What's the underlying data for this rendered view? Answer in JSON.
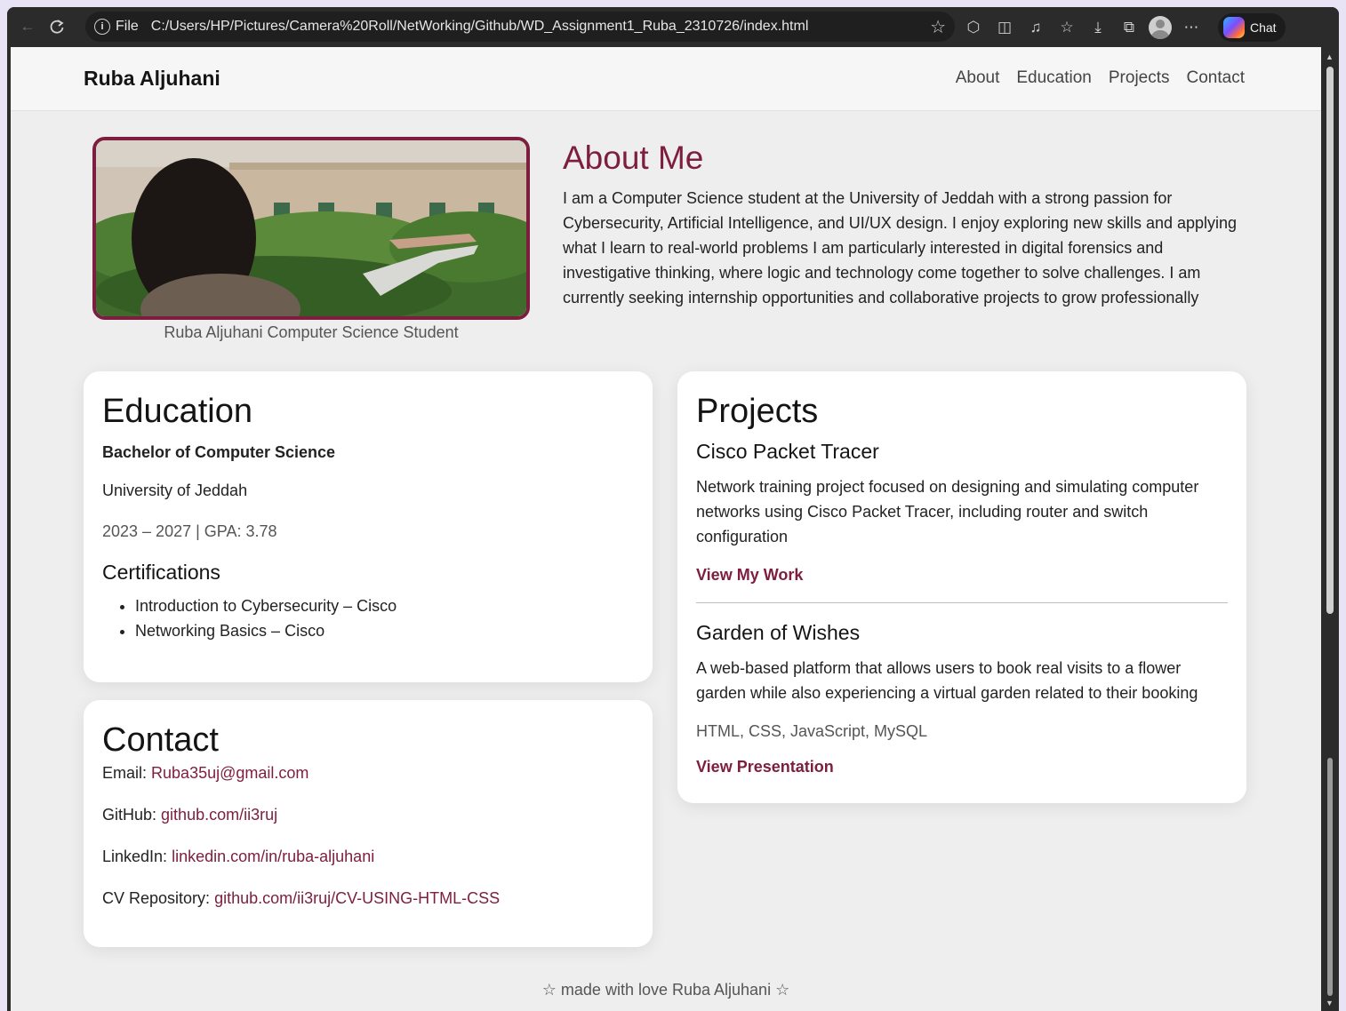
{
  "browser": {
    "back_icon": "←",
    "refresh_icon": "C",
    "file_label": "File",
    "url": "C:/Users/HP/Pictures/Camera%20Roll/NetWorking/Github/WD_Assignment1_Ruba_2310726/index.html",
    "chat_label": "Chat"
  },
  "header": {
    "brand": "Ruba Aljuhani",
    "nav": [
      "About",
      "Education",
      "Projects",
      "Contact"
    ]
  },
  "about": {
    "photo_caption": "Ruba Aljuhani Computer Science Student",
    "title": "About Me",
    "text": "I am a Computer Science student at the University of Jeddah with a strong passion for Cybersecurity, Artificial Intelligence, and UI/UX design. I enjoy exploring new skills and applying what I learn to real-world problems I am particularly interested in digital forensics and investigative thinking, where logic and technology come together to solve challenges. I am currently seeking internship opportunities and collaborative projects to grow professionally"
  },
  "education": {
    "title": "Education",
    "degree": "Bachelor of Computer Science",
    "university": "University of Jeddah",
    "years": "2023 – 2027 | GPA: 3.78",
    "certifications_title": "Certifications",
    "certifications": [
      "Introduction to Cybersecurity – Cisco",
      "Networking Basics – Cisco"
    ]
  },
  "contact": {
    "title": "Contact",
    "email_label": "Email:",
    "email": "Ruba35uj@gmail.com",
    "github_label": "GitHub:",
    "github": "github.com/ii3ruj",
    "linkedin_label": "LinkedIn:",
    "linkedin": "linkedin.com/in/ruba-aljuhani",
    "cv_label": "CV Repository:",
    "cv": "github.com/ii3ruj/CV-USING-HTML-CSS"
  },
  "projects": {
    "title": "Projects",
    "items": [
      {
        "name": "Cisco Packet Tracer",
        "description": "Network training project focused on designing and simulating computer networks using Cisco Packet Tracer, including router and switch configuration",
        "link": "View My Work"
      },
      {
        "name": "Garden of Wishes",
        "description": "A web-based platform that allows users to book real visits to a flower garden while also experiencing a virtual garden related to their booking",
        "tech": "HTML, CSS, JavaScript, MySQL",
        "link": "View Presentation"
      }
    ]
  },
  "footer": {
    "text": "☆ made with love Ruba Aljuhani ☆"
  },
  "colors": {
    "accent": "#7d1d3f",
    "page_background": "#eeeeee",
    "card_background": "#ffffff"
  }
}
